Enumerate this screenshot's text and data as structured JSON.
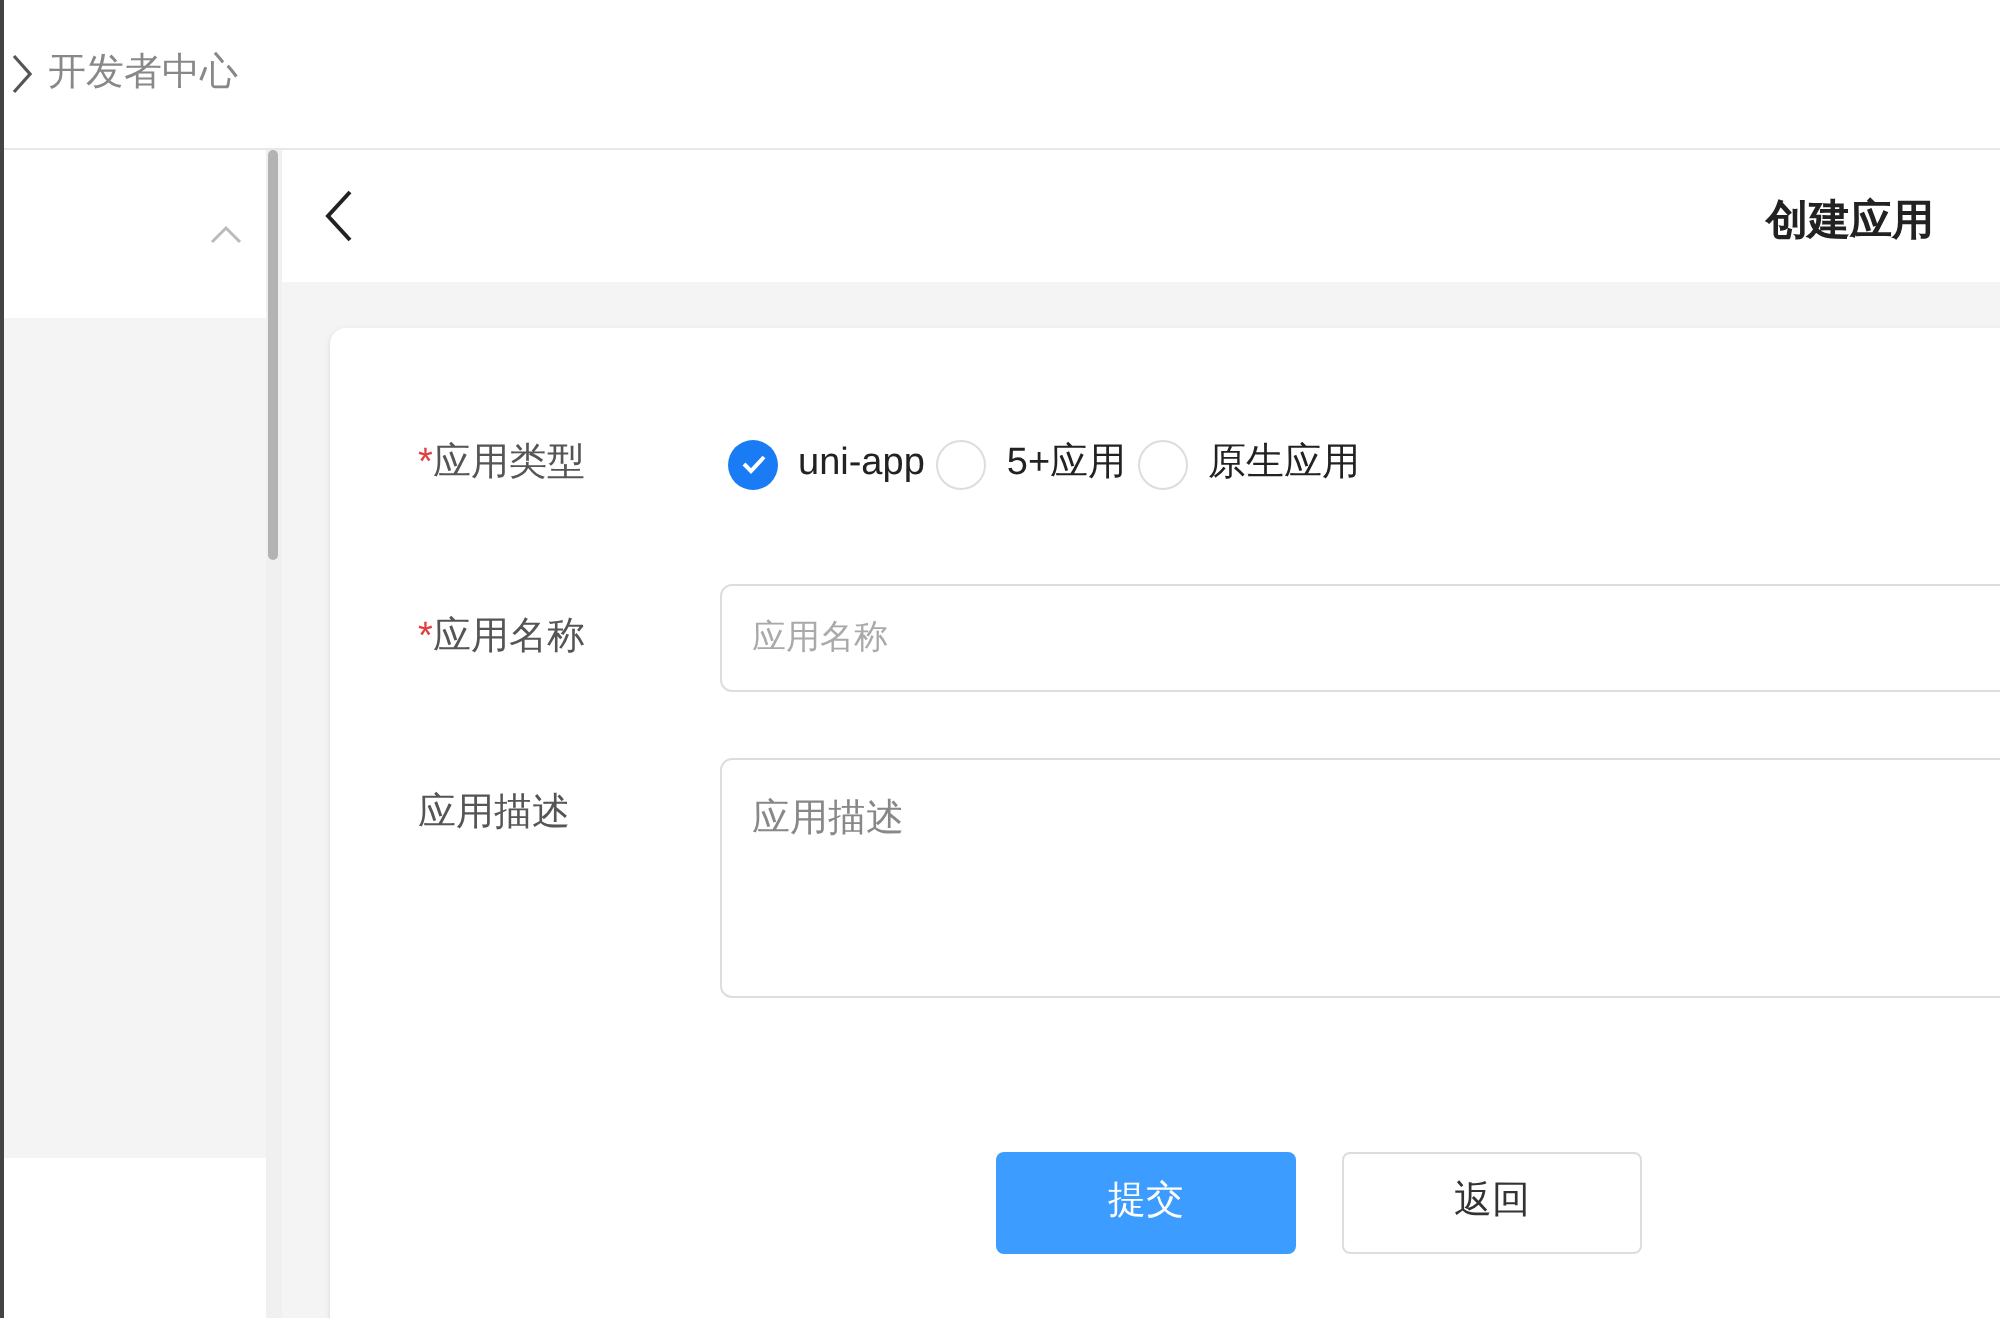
{
  "breadcrumb": {
    "label": "开发者中心"
  },
  "page_header": {
    "title": "创建应用"
  },
  "form": {
    "fields": [
      {
        "kind": "radio",
        "label": "应用类型",
        "required_mark": "*",
        "options": [
          {
            "label": "uni-app",
            "selected": true
          },
          {
            "label": "5+应用",
            "selected": false
          },
          {
            "label": "原生应用",
            "selected": false
          }
        ]
      },
      {
        "kind": "input",
        "label": "应用名称",
        "required_mark": "*",
        "placeholder": "应用名称"
      },
      {
        "kind": "textarea",
        "label": "应用描述",
        "placeholder": "应用描述"
      }
    ],
    "buttons": [
      {
        "kind": "primary",
        "label": "提交"
      },
      {
        "kind": "default",
        "label": "返回"
      }
    ]
  }
}
